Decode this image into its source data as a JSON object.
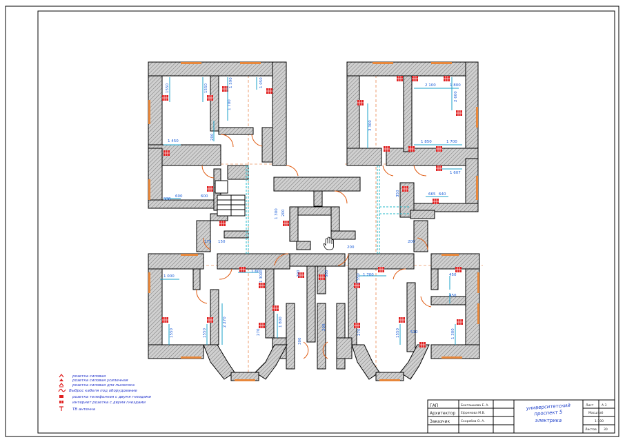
{
  "legend": {
    "items": [
      {
        "icon": "socket-icon",
        "label": "розетка силовая"
      },
      {
        "icon": "grounded-socket-icon",
        "label": "розетка силовая усиленная"
      },
      {
        "icon": "water-socket-icon",
        "label": "розетка силовая для пылесоса"
      },
      {
        "icon": "cable-outlet-icon",
        "label": "Выброс кабеля под оборудование"
      },
      {
        "icon": "phone-socket-icon",
        "label": "розетка телефонная с двумя гнездами"
      },
      {
        "icon": "internet-socket-icon",
        "label": "интернет розетка с двумя гнездами"
      },
      {
        "icon": "tv-socket-icon",
        "label": "TB антенна"
      }
    ]
  },
  "dimensions": {
    "d1550a": "1550",
    "d1550b": "1550",
    "d1590": "1 590",
    "d1050": "1 050",
    "d1700a": "1 700",
    "d1450": "1 450",
    "d200a": "200",
    "d938": "938",
    "d600a": "600",
    "d600b": "600",
    "d1300a": "1 300",
    "d200b": "200",
    "d175": "175",
    "d150": "150",
    "d2100": "2 100",
    "d1800": "1 800",
    "d2600": "2 600",
    "d3300": "3 300",
    "d1850": "1 850",
    "d1700b": "1 700",
    "d1607": "1 607",
    "d350": "350",
    "d665": "665",
    "d640": "640",
    "d200c": "200",
    "d200d": "200",
    "d1000": "1 000",
    "d1600": "1 600",
    "d1300b": "1 300",
    "d290": "290",
    "d380": "380",
    "d1550c": "1 550",
    "d1700c": "1 700",
    "d450a": "450",
    "d450b": "450",
    "d1550d": "1550",
    "d1550e": "1550",
    "d2270": "2 270",
    "d270a": "270",
    "d1800b": "1 800",
    "d300": "300",
    "d200e": "200",
    "d270b": "270",
    "d1550f": "1550",
    "d510": "510",
    "d1300c": "1 300"
  },
  "title_block": {
    "row1_role": "ГАП",
    "row1_name": "Бекташиева Е. А.",
    "row2_role": "Архитектор",
    "row2_name": "Ефремова М.В.",
    "row3_role": "Заказчик",
    "row3_name": "Скоробов О. А.",
    "project_line1": "университетский",
    "project_line2": "проспект 5",
    "sheet_name": "электрика",
    "sheet_label": "Лист",
    "sheet_value": "А 3",
    "scale_label": "Масштаб",
    "scale_value": "1:100",
    "sheets_label": "Листов",
    "sheets_value": "30"
  }
}
